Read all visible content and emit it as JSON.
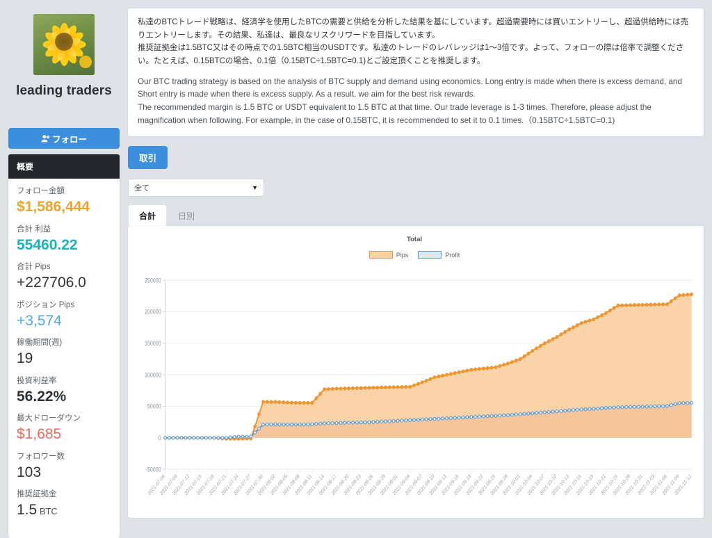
{
  "profile": {
    "avatar_icon": "sunflower-photo",
    "name": "leading traders",
    "follow_label": "フォロー",
    "follow_icon": "user-plus-icon"
  },
  "overview": {
    "header": "概要",
    "stats": [
      {
        "label": "フォロー金額",
        "value": "$1,586,444",
        "color": "#f0a32a",
        "bold": true,
        "unit": ""
      },
      {
        "label": "合計 利益",
        "value": "55460.22",
        "color": "#17b2bd",
        "bold": true,
        "unit": ""
      },
      {
        "label": "合計 Pips",
        "value": "+227706.0",
        "color": "#2f3337",
        "bold": false,
        "unit": ""
      },
      {
        "label": "ポジション Pips",
        "value": "+3,574",
        "color": "#4fa8e0",
        "bold": false,
        "unit": ""
      },
      {
        "label": "稼働期間(週)",
        "value": "19",
        "color": "#2f3337",
        "bold": false,
        "unit": ""
      },
      {
        "label": "投資利益率",
        "value": "56.22%",
        "color": "#2f3337",
        "bold": true,
        "unit": ""
      },
      {
        "label": "最大ドローダウン",
        "value": "$1,685",
        "color": "#f4685e",
        "bold": false,
        "unit": ""
      },
      {
        "label": "フォロワー数",
        "value": "103",
        "color": "#2f3337",
        "bold": false,
        "unit": ""
      },
      {
        "label": "推奨証拠金",
        "value": "1.5",
        "color": "#2f3337",
        "bold": false,
        "unit": "BTC"
      }
    ]
  },
  "description": {
    "jp_line1": "私達のBTCトレード戦略は、経済学を使用したBTCの需要と供給を分析した結果を基にしています。超過需要時には買いエントリーし、超過供給時には売りエントリーします。その結果、私達は、最良なリスクリワードを目指しています。",
    "jp_line2": "推奨証拠金は1.5BTC又はその時点での1.5BTC相当のUSDTです。私達のトレードのレバレッジは1〜3倍です。よって、フォローの際は倍率で調整ください。たとえば、0.15BTCの場合、0.1倍（0.15BTC÷1.5BTC=0.1)とご設定頂くことを推奨します。",
    "en_line1": "Our BTC trading strategy is based on the analysis of BTC supply and demand using economics. Long entry is made when there is excess demand, and Short entry is made when there is excess supply. As a result, we aim for the best risk rewards.",
    "en_line2": "The recommended margin is 1.5 BTC or USDT equivalent to 1.5 BTC at that time. Our trade leverage is 1-3 times. Therefore, please adjust the magnification when following. For example, in the case of 0.15BTC, it is recommended to set it to 0.1 times.（0.15BTC÷1.5BTC=0.1)"
  },
  "controls": {
    "trade_button": "取引",
    "filter_selected": "全て",
    "filter_chevron": "chevron-down-icon",
    "tabs": [
      {
        "label": "合計",
        "active": true
      },
      {
        "label": "日別",
        "active": false
      }
    ]
  },
  "chart_data": {
    "type": "area",
    "title": "Total",
    "xlabel": "",
    "ylabel": "",
    "ylim": [
      -50000,
      250000
    ],
    "yticks": [
      250000,
      200000,
      150000,
      100000,
      50000,
      0,
      -50000
    ],
    "ytick_labels": [
      "250000",
      "200000",
      "150000",
      "100000",
      "50000",
      "0",
      "-50000"
    ],
    "grid": true,
    "legend_position": "top-center",
    "legend": [
      "Pips",
      "Profit"
    ],
    "colors": {
      "pips_line": "#f0952e",
      "pips_fill": "#fad3a9",
      "profit_line": "#5b9bd5",
      "profit_fill": "#f0bc8f"
    },
    "x": [
      "2021-07-06",
      "2021-07-09",
      "2021-07-12",
      "2021-07-15",
      "2021-07-18",
      "2021-07-21",
      "2021-07-24",
      "2021-07-27",
      "2021-07-30",
      "2021-08-02",
      "2021-08-05",
      "2021-08-08",
      "2021-08-11",
      "2021-08-14",
      "2021-08-17",
      "2021-08-20",
      "2021-08-23",
      "2021-08-26",
      "2021-08-29",
      "2021-09-01",
      "2021-09-04",
      "2021-09-07",
      "2021-09-10",
      "2021-09-13",
      "2021-09-16",
      "2021-09-19",
      "2021-09-22",
      "2021-09-25",
      "2021-09-28",
      "2021-10-01",
      "2021-10-04",
      "2021-10-07",
      "2021-10-10",
      "2021-10-13",
      "2021-10-16",
      "2021-10-19",
      "2021-10-22",
      "2021-10-25",
      "2021-10-28",
      "2021-10-31",
      "2021-11-03",
      "2021-11-06",
      "2021-11-09",
      "2021-11-12"
    ],
    "series": [
      {
        "name": "Pips",
        "values": [
          0,
          0,
          0,
          0,
          0,
          -1500,
          -1500,
          -1200,
          57000,
          57000,
          56000,
          55500,
          55500,
          77000,
          78000,
          78500,
          79000,
          79500,
          80000,
          80500,
          81000,
          88000,
          96000,
          100000,
          104000,
          108000,
          110000,
          112000,
          118000,
          125000,
          138000,
          150000,
          160000,
          172000,
          182000,
          188000,
          198000,
          210000,
          210500,
          211000,
          211500,
          212000,
          226000,
          227706
        ]
      },
      {
        "name": "Profit",
        "values": [
          0,
          0,
          0,
          0,
          0,
          0,
          1800,
          2000,
          21000,
          21500,
          21000,
          21200,
          21500,
          23000,
          23500,
          24000,
          24500,
          25000,
          26000,
          27000,
          28000,
          29000,
          30000,
          31000,
          32000,
          33000,
          34000,
          35000,
          36000,
          37500,
          39000,
          40500,
          42000,
          43500,
          45000,
          46000,
          47500,
          48500,
          49000,
          49500,
          50000,
          50500,
          55000,
          55460
        ]
      }
    ]
  }
}
